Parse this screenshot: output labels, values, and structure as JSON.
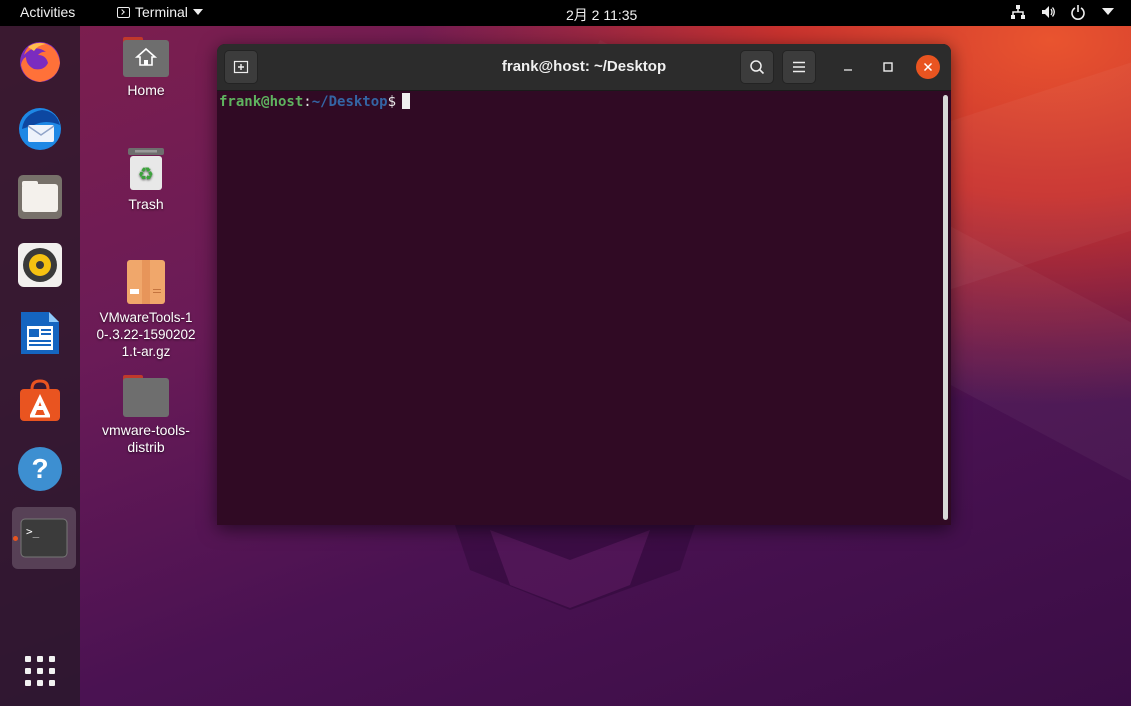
{
  "topbar": {
    "activities": "Activities",
    "app_name": "Terminal",
    "clock": "2月 2  11:35",
    "tray": [
      "network-icon",
      "volume-icon",
      "power-icon",
      "chevron-down-icon"
    ]
  },
  "dock": {
    "items": [
      {
        "name": "firefox",
        "icon": "firefox-icon"
      },
      {
        "name": "thunderbird",
        "icon": "thunderbird-icon"
      },
      {
        "name": "files",
        "icon": "files-icon"
      },
      {
        "name": "rhythmbox",
        "icon": "rhythmbox-icon"
      },
      {
        "name": "libreoffice-writer",
        "icon": "writer-icon"
      },
      {
        "name": "ubuntu-software",
        "icon": "software-icon"
      },
      {
        "name": "help",
        "icon": "help-icon"
      },
      {
        "name": "terminal",
        "icon": "terminal-icon",
        "active": true
      }
    ],
    "apps_grid": "show-applications-icon"
  },
  "desktop": {
    "icons": [
      {
        "label": "Home"
      },
      {
        "label": "Trash"
      },
      {
        "label": "VMwareTools-10-.3.22-15902021.t-ar.gz"
      },
      {
        "label": "vmware-tools-distrib"
      }
    ]
  },
  "terminal": {
    "title": "frank@host: ~/Desktop",
    "prompt_user": "frank@host",
    "prompt_sep": ":",
    "prompt_path": "~/Desktop",
    "prompt_symbol": "$"
  },
  "colors": {
    "accent": "#e95420",
    "terminal_bg": "#300a24",
    "header_bg": "#2c2c2c",
    "prompt_user": "#5fb35f",
    "prompt_path": "#3465a4"
  }
}
